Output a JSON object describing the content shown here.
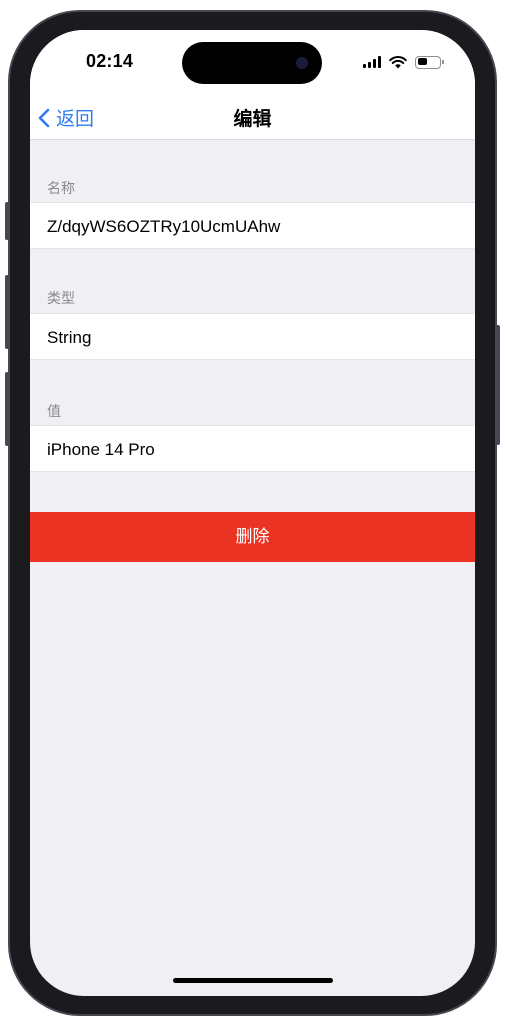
{
  "status_bar": {
    "time": "02:14",
    "battery_level": 0.45
  },
  "nav": {
    "back_label": "返回",
    "title": "编辑"
  },
  "fields": [
    {
      "header": "名称",
      "value": "Z/dqyWS6OZTRy10UcmUAhw"
    },
    {
      "header": "类型",
      "value": "String"
    },
    {
      "header": "值",
      "value": "iPhone 14 Pro"
    }
  ],
  "actions": {
    "delete_label": "删除"
  },
  "colors": {
    "accent": "#2f7cf6",
    "destructive": "#ea3323",
    "background": "#f0eff4"
  },
  "icons": {
    "back": "chevron-left-icon",
    "signal": "cellular-signal-icon",
    "wifi": "wifi-icon",
    "battery": "battery-icon"
  }
}
